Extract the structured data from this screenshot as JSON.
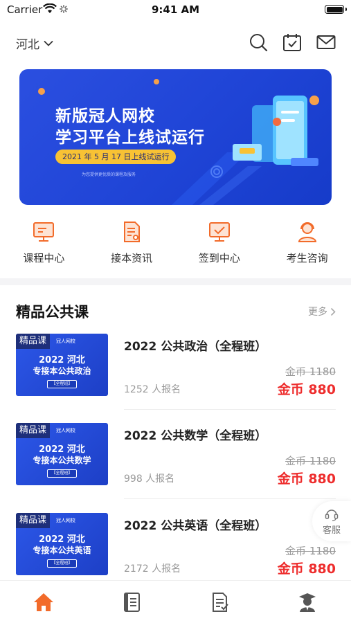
{
  "status_bar": {
    "carrier": "Carrier",
    "time": "9:41 AM"
  },
  "header": {
    "region": "河北",
    "icons": [
      "search-icon",
      "calendar-check-icon",
      "mail-icon"
    ]
  },
  "banner": {
    "title_line1": "新版冠人网校",
    "title_line2": "学习平台上线试运行",
    "date_pill": "2021 年 5 月 17 日上线试运行",
    "subtitle": "为您提供更优质的课程及服务"
  },
  "quick_nav": [
    {
      "label": "课程中心",
      "icon": "monitor-icon"
    },
    {
      "label": "接本资讯",
      "icon": "document-icon"
    },
    {
      "label": "签到中心",
      "icon": "signin-screen-icon"
    },
    {
      "label": "考生咨询",
      "icon": "headset-person-icon"
    }
  ],
  "section": {
    "title": "精品公共课",
    "more": "更多"
  },
  "courses": [
    {
      "thumb_tag": "精品课",
      "thumb_logo": "冠人网校",
      "thumb_line1": "2022 河北",
      "thumb_line2": "专接本公共政治",
      "thumb_badge": "【全程班】",
      "name": "2022 公共政治（全程班）",
      "enrolled": "1252 人报名",
      "old_price": "金币 1180",
      "new_price": "金币 880"
    },
    {
      "thumb_tag": "精品课",
      "thumb_logo": "冠人网校",
      "thumb_line1": "2022 河北",
      "thumb_line2": "专接本公共数学",
      "thumb_badge": "【全程班】",
      "name": "2022 公共数学（全程班）",
      "enrolled": "998 人报名",
      "old_price": "金币 1180",
      "new_price": "金币 880"
    },
    {
      "thumb_tag": "精品课",
      "thumb_logo": "冠人网校",
      "thumb_line1": "2022 河北",
      "thumb_line2": "专接本公共英语",
      "thumb_badge": "【全程班】",
      "name": "2022 公共英语（全程班）",
      "enrolled": "2172 人报名",
      "old_price": "金币 1180",
      "new_price": "金币 880"
    }
  ],
  "service": {
    "label": "客服"
  },
  "tab_bar": {
    "active_color": "#f26b2a",
    "inactive_color": "#555555",
    "tabs": [
      "home-icon",
      "book-icon",
      "exam-paper-icon",
      "profile-graduate-icon"
    ]
  },
  "colors": {
    "accent": "#f26b2a",
    "price_red": "#ee2d2d",
    "banner_blue": "#1f44d6",
    "pill_yellow": "#f8c234"
  }
}
